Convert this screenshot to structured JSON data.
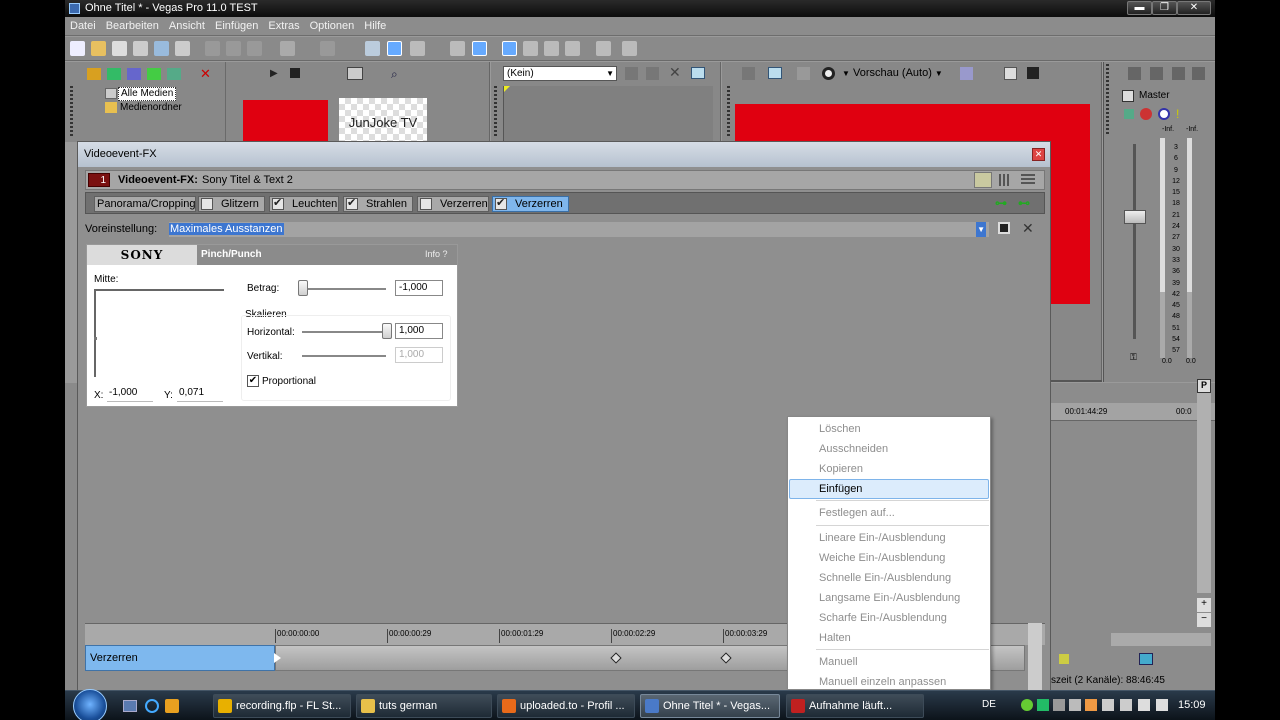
{
  "window": {
    "title": "Ohne Titel * - Vegas Pro 11.0 TEST",
    "minimize": "▬",
    "maximize": "❐",
    "close": "✕"
  },
  "menu": [
    "Datei",
    "Bearbeiten",
    "Ansicht",
    "Einfügen",
    "Extras",
    "Optionen",
    "Hilfe"
  ],
  "media": {
    "items": [
      "Alle Medien",
      "Medienordner"
    ],
    "thumb_label": "JunJoke TV"
  },
  "trimmer": {
    "select": "(Kein)"
  },
  "preview": {
    "mode": "Vorschau (Auto)"
  },
  "master": {
    "label": "Master",
    "inf_left": "-Inf.",
    "inf_right": "-Inf.",
    "val_left": "0.0",
    "val_right": "0.0",
    "scale": [
      "3",
      "6",
      "9",
      "12",
      "15",
      "18",
      "21",
      "24",
      "27",
      "30",
      "33",
      "36",
      "39",
      "42",
      "45",
      "48",
      "51",
      "54",
      "57"
    ]
  },
  "timeline_right": {
    "time1": "00:01:44:29",
    "time2": "00:0",
    "status": "szeit (2 Kanäle): 88:46:45"
  },
  "dialog": {
    "title": "Videoevent-FX",
    "fx_tag": "1",
    "fx_header_label": "Videoevent-FX:",
    "fx_header_value": "Sony Titel & Text 2",
    "chain": [
      {
        "label": "Panorama/Cropping",
        "checkbox": false,
        "checked": false,
        "selected": false
      },
      {
        "label": "Glitzern",
        "checkbox": true,
        "checked": false,
        "selected": false
      },
      {
        "label": "Leuchten",
        "checkbox": true,
        "checked": true,
        "selected": false
      },
      {
        "label": "Strahlen",
        "checkbox": true,
        "checked": true,
        "selected": false
      },
      {
        "label": "Verzerren",
        "checkbox": true,
        "checked": false,
        "selected": false
      },
      {
        "label": "Verzerren",
        "checkbox": true,
        "checked": true,
        "selected": true
      }
    ],
    "preset_label": "Voreinstellung:",
    "preset_value": "Maximales Ausstanzen",
    "plugin": {
      "brand": "SONY",
      "name": "Pinch/Punch",
      "info": "Info  ?",
      "mitte": "Mitte:",
      "x_label": "X:",
      "x_value": "-1,000",
      "y_label": "Y:",
      "y_value": "0,071",
      "betrag_label": "Betrag:",
      "betrag_value": "-1,000",
      "betrag_level": 0.0,
      "skalieren_label": "Skalieren",
      "horizontal_label": "Horizontal:",
      "horizontal_value": "1,000",
      "horizontal_level": 1.0,
      "vertikal_label": "Vertikal:",
      "vertikal_value": "1,000",
      "proportional_label": "Proportional",
      "proportional_checked": true
    },
    "timeline": {
      "ticks": [
        "00:00:00:00",
        "00:00:00:29",
        "00:00:01:29",
        "00:00:02:29",
        "00:00:03:29"
      ],
      "track_label": "Verzerren"
    }
  },
  "context_menu": [
    {
      "label": "Löschen",
      "enabled": false
    },
    {
      "label": "Ausschneiden",
      "enabled": false
    },
    {
      "label": "Kopieren",
      "enabled": false
    },
    {
      "label": "Einfügen",
      "enabled": true,
      "highlighted": true
    },
    {
      "sep": true
    },
    {
      "label": "Festlegen auf...",
      "enabled": false
    },
    {
      "sep": true
    },
    {
      "label": "Lineare Ein-/Ausblendung",
      "enabled": false
    },
    {
      "label": "Weiche Ein-/Ausblendung",
      "enabled": false
    },
    {
      "label": "Schnelle Ein-/Ausblendung",
      "enabled": false
    },
    {
      "label": "Langsame Ein-/Ausblendung",
      "enabled": false
    },
    {
      "label": "Scharfe Ein-/Ausblendung",
      "enabled": false
    },
    {
      "label": "Halten",
      "enabled": false
    },
    {
      "sep": true
    },
    {
      "label": "Manuell",
      "enabled": false
    },
    {
      "label": "Manuell einzeln anpassen",
      "enabled": false
    }
  ],
  "taskbar": {
    "tasks": [
      {
        "label": "recording.flp - FL St...",
        "color": "#e8b000",
        "active": false
      },
      {
        "label": "tuts german",
        "color": "#e8c04a",
        "active": false
      },
      {
        "label": "uploaded.to - Profil ...",
        "color": "#e86a1a",
        "active": false
      },
      {
        "label": "Ohne Titel * - Vegas...",
        "color": "#4a7ac8",
        "active": true
      },
      {
        "label": "Aufnahme läuft...",
        "color": "#c02020",
        "active": false
      }
    ],
    "lang": "DE",
    "clock": "15:09"
  }
}
